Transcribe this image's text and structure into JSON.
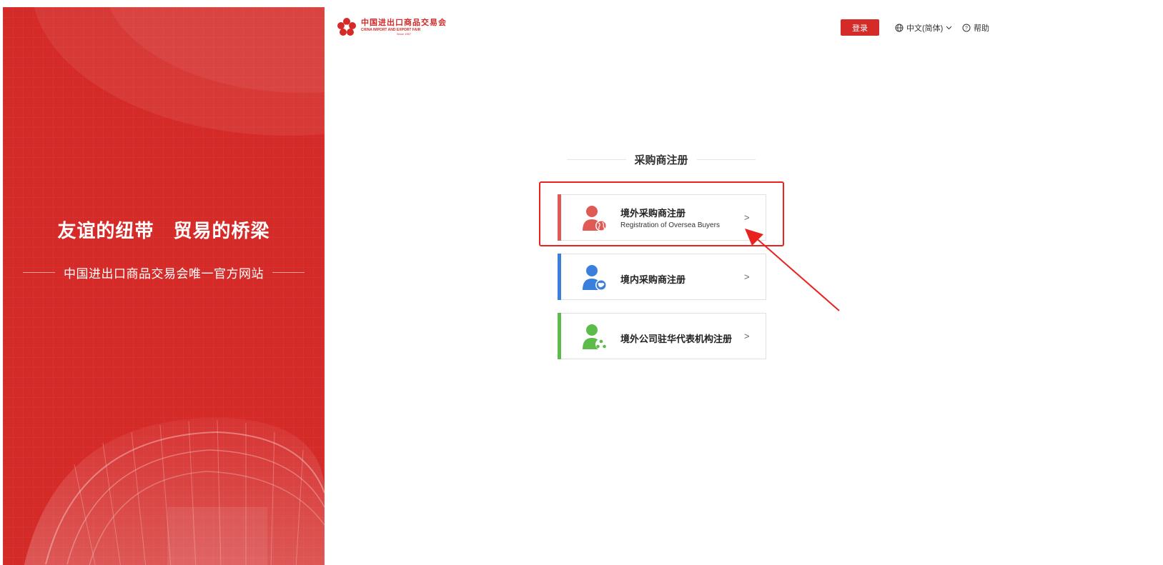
{
  "left_panel": {
    "slogan": "友谊的纽带　贸易的桥梁",
    "sub_slogan": "中国进出口商品交易会唯一官方网站",
    "bg_color": "#d42a28"
  },
  "header": {
    "logo_cn": "中国进出口商品交易会",
    "logo_en": "CHINA IMPORT AND EXPORT FAIR",
    "logo_since": "Since 1957",
    "login_label": "登录",
    "language_label": "中文(简体)",
    "help_label": "帮助",
    "icons": {
      "language": "globe-icon",
      "language_caret": "chevron-down-icon",
      "help": "question-circle-icon"
    }
  },
  "main": {
    "section_title": "采购商注册",
    "options": [
      {
        "title": "境外采购商注册",
        "subtitle": "Registration of  Oversea Buyers",
        "color": "#e05a55",
        "icon": "user-globe-icon",
        "arrow": ">"
      },
      {
        "title": "境内采购商注册",
        "subtitle": "",
        "color": "#3a7fdc",
        "icon": "user-china-icon",
        "arrow": ">"
      },
      {
        "title": "境外公司驻华代表机构注册",
        "subtitle": "",
        "color": "#5dbb4a",
        "icon": "user-group-icon",
        "arrow": ">"
      }
    ]
  },
  "annotation": {
    "highlight_color": "#e8231f"
  }
}
